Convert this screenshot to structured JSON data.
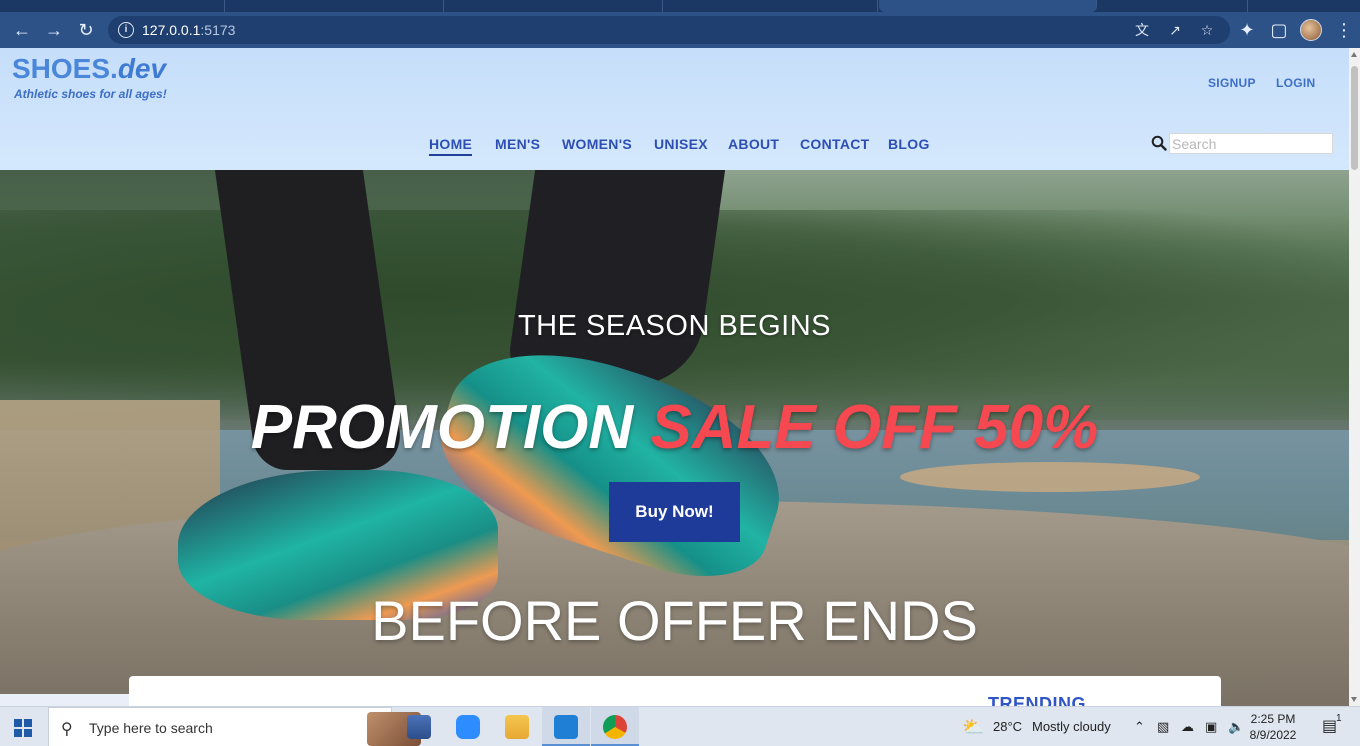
{
  "browser": {
    "url_host": "127.0.0.1",
    "url_port": ":5173"
  },
  "site": {
    "logo_main": "SHOES.",
    "logo_suffix": "dev",
    "tagline": "Athletic shoes for all ages!",
    "auth": {
      "signup": "SIGNUP",
      "login": "LOGIN"
    },
    "nav": [
      "HOME",
      "MEN'S",
      "WOMEN'S",
      "UNISEX",
      "ABOUT",
      "CONTACT",
      "BLOG"
    ],
    "search_placeholder": "Search"
  },
  "hero": {
    "season": "THE SEASON BEGINS",
    "promo_word": "PROMOTION",
    "promo_sale": "SALE OFF 50%",
    "cta": "Buy Now!",
    "before": "BEFORE OFFER ENDS"
  },
  "trending": {
    "label": "TRENDING"
  },
  "taskbar": {
    "search_text": "Type here to search",
    "weather_temp": "28°C",
    "weather_desc": "Mostly cloudy",
    "time": "2:25 PM",
    "date": "8/9/2022",
    "notification_count": "1"
  },
  "colors": {
    "accent_blue": "#2d4fb3",
    "cta_bg": "#1f3b9a",
    "sale_red": "#f54850",
    "logo_blue": "#4a86d9"
  }
}
